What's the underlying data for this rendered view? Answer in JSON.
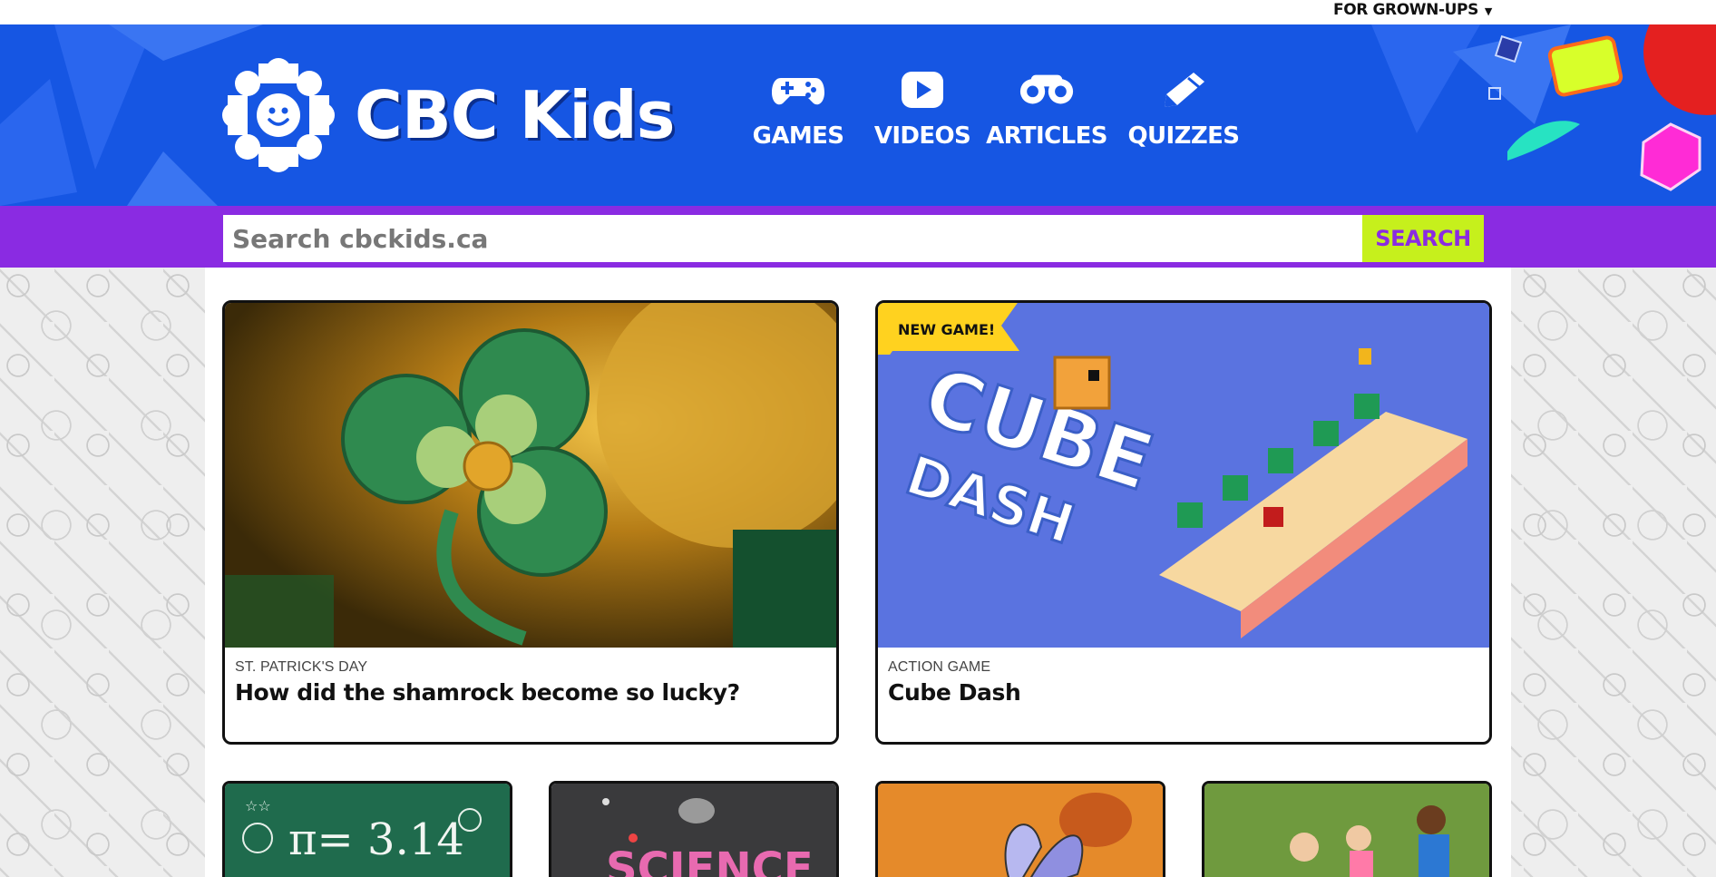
{
  "utility": {
    "grownups_label": "FOR GROWN-UPS",
    "caret_icon": "caret-down-icon"
  },
  "header": {
    "logo_alt": "CBC Kids",
    "wordmark": "CBC Kids",
    "brand_color": "#1656e3",
    "nav": [
      {
        "label": "GAMES",
        "icon": "gamepad-icon"
      },
      {
        "label": "VIDEOS",
        "icon": "play-icon"
      },
      {
        "label": "ARTICLES",
        "icon": "binoculars-icon"
      },
      {
        "label": "QUIZZES",
        "icon": "pencil-icon"
      }
    ]
  },
  "search": {
    "placeholder": "Search cbckids.ca",
    "value": "",
    "button_label": "SEARCH",
    "band_color": "#8a2be2",
    "button_color": "#c6f01c"
  },
  "features": [
    {
      "kicker": "ST. PATRICK'S DAY",
      "title": "How did the shamrock become so lucky?",
      "image": "shamrock-image"
    },
    {
      "badge": "NEW GAME!",
      "kicker": "ACTION GAME",
      "title": "Cube Dash",
      "image": "cube-dash-image"
    }
  ],
  "thumbnails": [
    {
      "image": "chalkboard-pi-image",
      "visible_text": "π = 3.14"
    },
    {
      "image": "science-table-image",
      "visible_text": "SCIENCE"
    },
    {
      "image": "butterfly-image"
    },
    {
      "image": "kids-playing-image"
    }
  ]
}
